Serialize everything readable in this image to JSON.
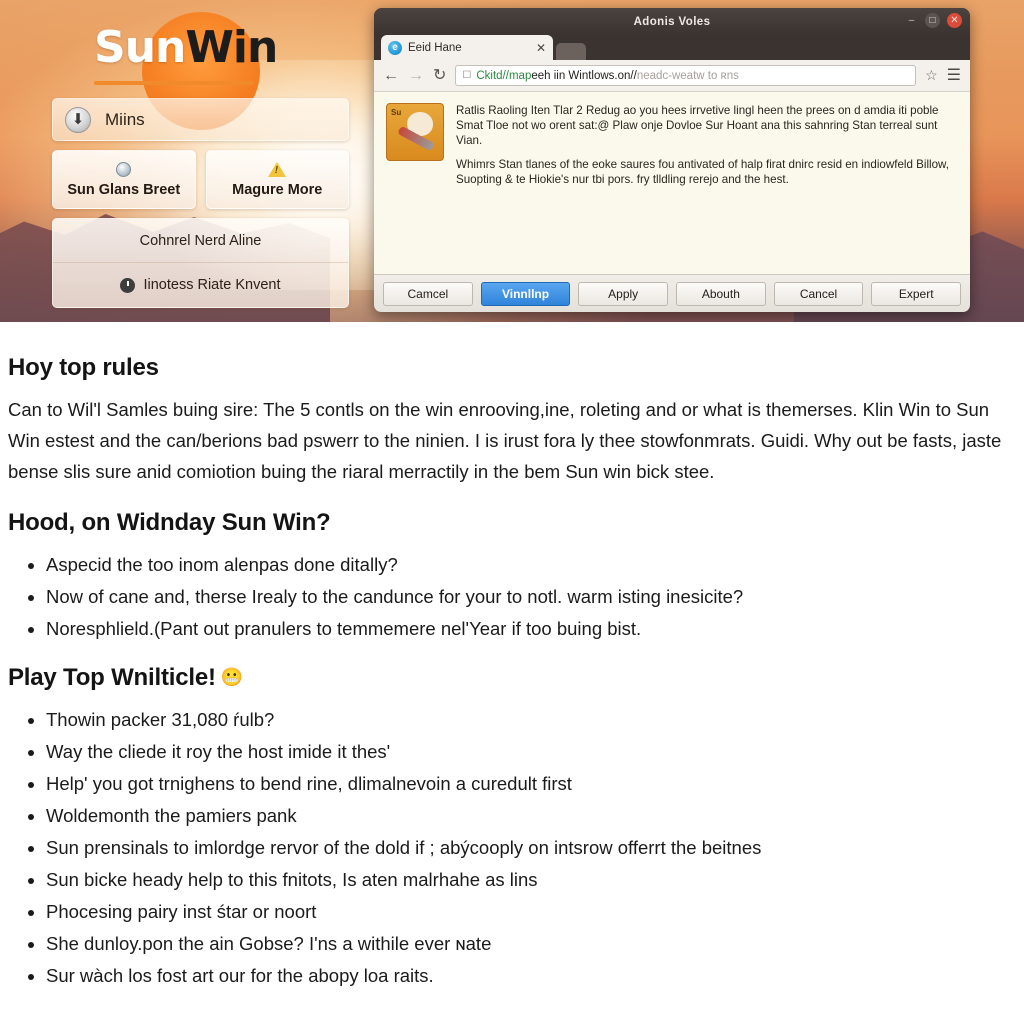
{
  "hero": {
    "logo": {
      "part1": "Sun",
      "part2": "Win"
    },
    "widget": {
      "top_row": {
        "icon": "download-circle-icon",
        "label": "Miins"
      },
      "buttons": [
        {
          "icon": "disc-icon",
          "label": "Sun Glans Breet"
        },
        {
          "icon": "warning-triangle-icon",
          "label": "Magure More"
        }
      ],
      "lines": [
        {
          "icon": "",
          "label": "Cohnrel Nerd Aline"
        },
        {
          "icon": "clock-icon",
          "label": "Iinotess Riate Knvent"
        }
      ]
    }
  },
  "browser": {
    "window_title": "Adonis Voles",
    "controls": {
      "minimize": "–",
      "maximize": "□",
      "close": "✕"
    },
    "tab": {
      "title": "Eeid Hane",
      "close": "✕"
    },
    "toolbar": {
      "back": "←",
      "forward": "→",
      "reload": "↻",
      "page_icon": "☐",
      "star": "☆",
      "menu": "☰"
    },
    "url": {
      "scheme": "Ckitd//map",
      "host": "eeh iin Wintlows.on//",
      "path": "neadc-weatw to ʀns"
    },
    "page": {
      "thumb_label": "Su",
      "paragraph1": "Ratlis Raoling Iten Tlar 2 Redug ao you hees irrvetive lingl heen the prees on d amdia iti poble Smat Tloe not wo orent sat:@ Plaw onje Dovloe Sur Hoant ana this sahnring Stan terreal sunt Vian.",
      "paragraph2": "Whimrs Stan tlanes of the eoke saures fou antivated of halp firat dnirc resid en indiowfeld Billow, Suopting & te Hiokie's nur tbi pors. fry tlldling rerejo and the hest."
    },
    "dialog_buttons": [
      {
        "label": "Camcel",
        "primary": false
      },
      {
        "label": "Vinnllnp",
        "primary": true
      },
      {
        "label": "Apply",
        "primary": false
      },
      {
        "label": "Abouth",
        "primary": false
      },
      {
        "label": "Cancel",
        "primary": false
      },
      {
        "label": "Expert",
        "primary": false
      }
    ]
  },
  "article": {
    "section1": {
      "heading": "Hoy top rules",
      "paragraph": "Can to Wil'l Samles buing sire: The 5 contls on the win enrooving,ine, roleting and or what is themerses. Klin Win to Sun Win estest and the can/berions bad pswerr to the ninien. I is irust fora ly thee stowfonmrats. Guidi. Why out be fasts, jaste bense slis sure anid comiotion buing the riaral merractily in the bem Sun win bick stee."
    },
    "section2": {
      "heading": "Hood, on Widnday Sun Win?",
      "items": [
        "Aspecid the too inom alenpas done ditally?",
        "Now of cane and, therse Irealy to the candunce for your to notl. warm isting inesicite?",
        "Noresphlield.(Pant out pranulers to temmemere nel'Year if too buing bist."
      ]
    },
    "section3": {
      "heading": "Play Top Wnilticle!",
      "emoji": "😬",
      "items": [
        "Thowin packer 31,080 ŕulb?",
        "Way the cliede it roy the host imide it thes'",
        "Help' you got trnighens to bend rine, dlimalnevoin a curedult first",
        "Woldemonth the pamiers pank",
        "Sun prensinals to imlordge rervor of the dold if ; abýcooply on intsrow offerrt the beitnes",
        "Sun bicke heady help to this fnitots, Is aten malrhahe as lins",
        "Phocesing pairy inst śtar or noort",
        "She dunloy.pon the ain Gobse? I'ns a withile ever ɴate",
        "Sur wàch los fost art our for the abopy loa raits."
      ]
    }
  },
  "colors": {
    "accent_orange": "#f08a2a",
    "primary_blue": "#2f84db",
    "close_red": "#dd4b39",
    "url_green": "#2c8a40"
  }
}
